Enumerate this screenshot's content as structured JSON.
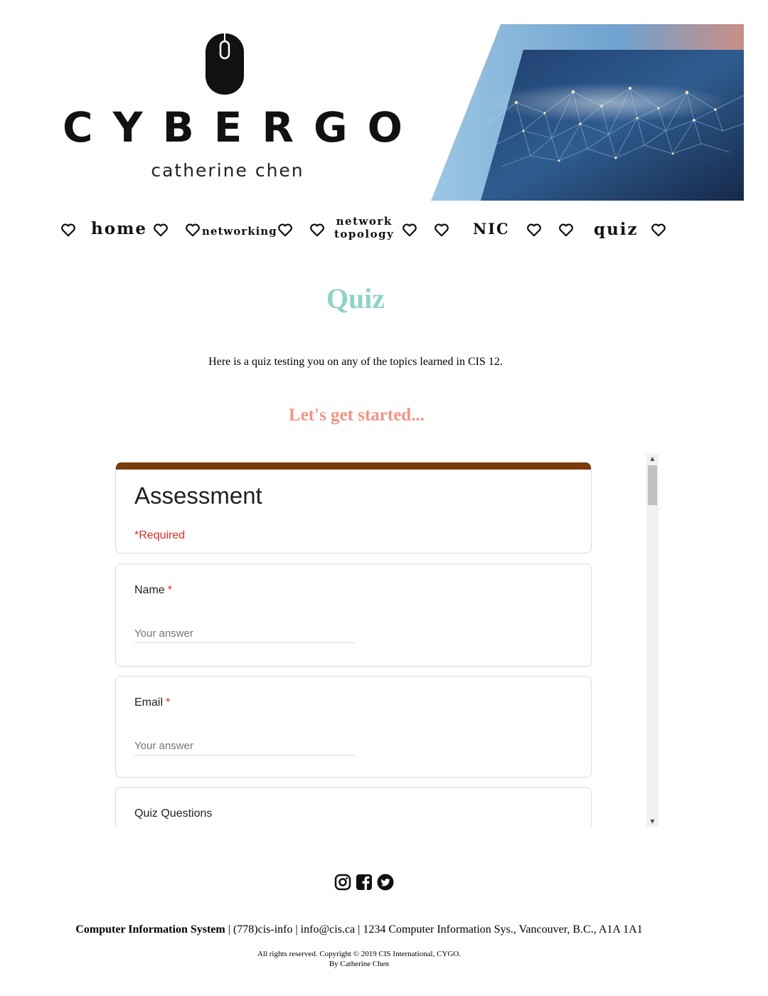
{
  "brand": {
    "name": "CYBERGO",
    "tagline": "catherine chen"
  },
  "nav": {
    "items": [
      {
        "label": "home"
      },
      {
        "label": "networking"
      },
      {
        "label_line1": "network",
        "label_line2": "topology"
      },
      {
        "label": "NIC"
      },
      {
        "label": "quiz"
      }
    ]
  },
  "main": {
    "title": "Quiz",
    "intro": "Here is a quiz testing you on any of the topics learned in CIS 12.",
    "cta": "Let's get started..."
  },
  "form": {
    "title": "Assessment",
    "required_star": "*",
    "required_text": "Required",
    "accent_color": "#7b3b0c",
    "questions": [
      {
        "label": "Name",
        "required_mark": "*",
        "placeholder": "Your answer",
        "value": ""
      },
      {
        "label": "Email",
        "required_mark": "*",
        "placeholder": "Your answer",
        "value": ""
      }
    ],
    "section_title": "Quiz Questions"
  },
  "footer": {
    "company": "Computer Information System",
    "contact_rest": " | (778)cis-info | info@cis.ca | 1234 Computer Information Sys., Vancouver, B.C., A1A 1A1",
    "copyright": "All rights reserved. Copyright © 2019 CIS International, CYGO.",
    "author": "By Catherine Chen",
    "socials": [
      "instagram-icon",
      "facebook-icon",
      "twitter-icon"
    ]
  },
  "colors": {
    "title": "#8fd3c9",
    "cta": "#f29486",
    "required": "#d93025"
  }
}
